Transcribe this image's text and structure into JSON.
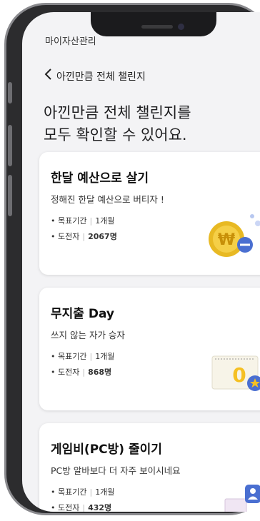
{
  "header": {
    "previous_title": "마이자산관리",
    "back_icon": "chevron-left-icon",
    "title": "아낀만큼 전체 챌린지"
  },
  "headline": {
    "line1": "아낀만큼 전체 챌린지를",
    "line2": "모두 확인할 수 있어요."
  },
  "challenges": [
    {
      "title": "한달 예산으로 살기",
      "description": "정해진 한달 예산으로 버티자 !",
      "period_label": "• 목표기간",
      "period_value": "1개월",
      "participants_label": "• 도전자",
      "participants_value": "2067명",
      "icon": "coin-minus-icon"
    },
    {
      "title": "무지출 Day",
      "description": "쓰지 않는 자가 승자",
      "period_label": "• 목표기간",
      "period_value": "1개월",
      "participants_label": "• 도전자",
      "participants_value": "868명",
      "icon": "calendar-zero-icon"
    },
    {
      "title": "게임비(PC방) 줄이기",
      "description": "PC방 알바보다 더 자주 보이시네요",
      "period_label": "• 목표기간",
      "period_value": "1개월",
      "participants_label": "• 도전자",
      "participants_value": "432명",
      "icon": "pc-user-icon"
    }
  ],
  "colors": {
    "background": "#f3f3f5",
    "card": "#ffffff",
    "coin": "#e8b923",
    "accent": "#4a6fd1",
    "frame": "#2c2c2e"
  }
}
